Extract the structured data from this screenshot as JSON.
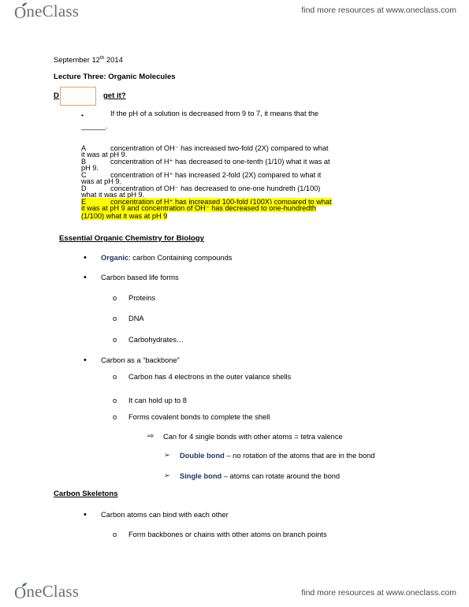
{
  "branding": {
    "logo_text_one": "O",
    "logo_text_rest": "neClass",
    "tagline": "find more resources at www.oneclass.com"
  },
  "document": {
    "date": "September 12th 2014",
    "date_main": "September 12",
    "date_sup": "th",
    "date_year": " 2014",
    "lecture_title": "Lecture Three: Organic Molecules",
    "do_you_get_it": "D                  get it?",
    "do_prefix": "D",
    "do_suffix": "get it?",
    "question": {
      "bullet": "•",
      "text": "If the pH of a solution is decreased from 9 to 7, it means that the",
      "blank": "______."
    },
    "options": [
      {
        "letter": "A",
        "line1": "concentration of OH⁻ has increased two-fold (2X) compared to what",
        "line2": "it was at pH 9."
      },
      {
        "letter": "B",
        "line1": "concentration of H⁺ has decreased to one-tenth (1/10) what it was at",
        "line2": "pH 9."
      },
      {
        "letter": "C",
        "line1": "concentration of H⁺ has increased 2-fold (2X) compared to what it",
        "line2": "was at pH 9."
      },
      {
        "letter": "D",
        "line1": "concentration of OH⁻ has decreased to one-one hundreth (1/100)",
        "line2": "what it was at pH 9."
      },
      {
        "letter": "E",
        "line1": "concentration of H⁺ has increased 100-fold (100X) compared to what",
        "line2": "it was at pH 9 and concentration of OH⁻ has decreased to one-hundredth",
        "line3": "(1/100) what it was at pH 9",
        "highlighted": true
      }
    ],
    "sections": [
      {
        "heading": "Essential Organic Chemistry for Biology",
        "items": [
          {
            "level": 1,
            "bullet": "•",
            "emphasis": "Organic",
            "text": ": carbon Containing compounds"
          },
          {
            "level": 1,
            "bullet": "•",
            "text": "Carbon based life forms"
          },
          {
            "level": 2,
            "bullet": "o",
            "text": "Proteins"
          },
          {
            "level": 2,
            "bullet": "o",
            "text": "DNA"
          },
          {
            "level": 2,
            "bullet": "o",
            "text": "Carbohydrates…"
          },
          {
            "level": 1,
            "bullet": "•",
            "text": "Carbon as a “backbone”"
          },
          {
            "level": 2,
            "bullet": "o",
            "text": "Carbon has 4 electrons in the outer valance shells"
          },
          {
            "level": 2,
            "bullet": "o",
            "text": "It can hold up to 8"
          },
          {
            "level": 2,
            "bullet": "o",
            "text": "Forms covalent bonds to complete the shell"
          },
          {
            "level": 3,
            "bullet": "⇨",
            "text": "Can for 4 single bonds with other atoms = tetra valence"
          },
          {
            "level": 4,
            "bullet": "➢",
            "emphasis": "Double bond",
            "text": " – no rotation of the atoms that are in the bond"
          },
          {
            "level": 4,
            "bullet": "➢",
            "emphasis": "Single bond",
            "text": " – atoms can rotate around the bond"
          }
        ]
      },
      {
        "heading": "Carbon Skeletons",
        "items": [
          {
            "level": 1,
            "bullet": "•",
            "text": "Carbon atoms can bind with each other"
          },
          {
            "level": 2,
            "bullet": "o",
            "text": "Form backbones or chains with other atoms on branch points"
          }
        ]
      }
    ]
  },
  "colors": {
    "accent_blue": "#1F3864",
    "highlight_yellow": "#FFFF00",
    "callout_orange": "#E8A35C",
    "brand_gray": "#6E6E6E",
    "leaf_green": "#2E7D4F"
  }
}
